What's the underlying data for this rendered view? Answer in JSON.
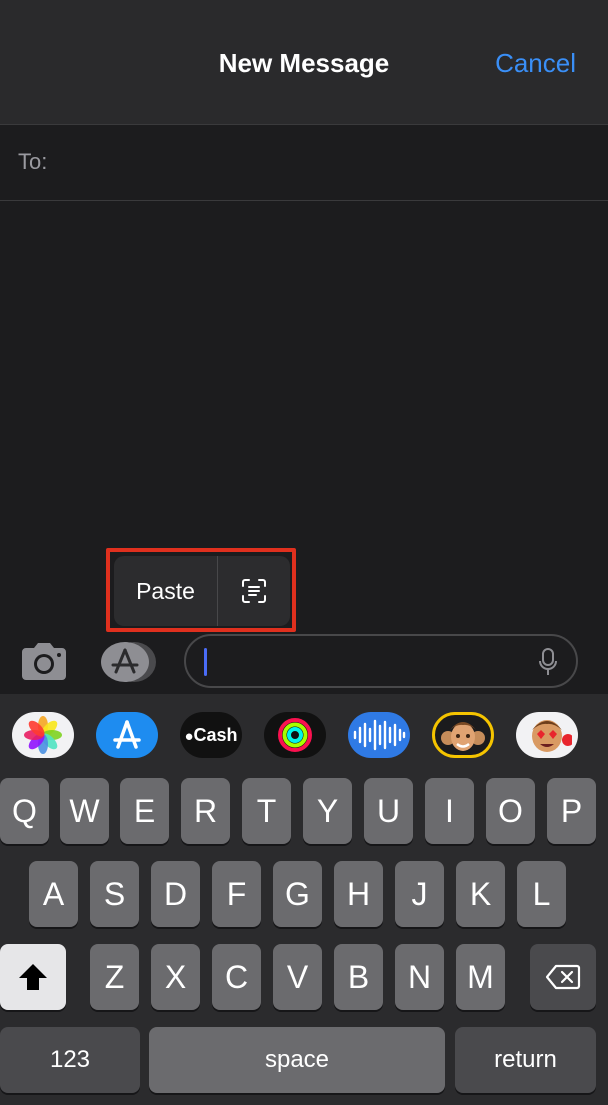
{
  "header": {
    "title": "New Message",
    "cancel_label": "Cancel"
  },
  "recipient": {
    "label": "To:",
    "value": ""
  },
  "edit_menu": {
    "paste_label": "Paste",
    "scan_icon": "scan-text-icon"
  },
  "compose": {
    "value": "",
    "camera_icon": "camera-icon",
    "apps_icon": "app-store-icon",
    "mic_icon": "microphone-icon"
  },
  "app_strip": [
    {
      "name": "Photos",
      "icon": "photos-icon"
    },
    {
      "name": "App Store",
      "icon": "app-store-icon"
    },
    {
      "name": "Cash",
      "icon": "apple-cash-icon",
      "text": "Cash"
    },
    {
      "name": "Activity",
      "icon": "activity-rings-icon"
    },
    {
      "name": "Audio",
      "icon": "audio-waveform-icon"
    },
    {
      "name": "Memoji",
      "icon": "memoji-icon"
    },
    {
      "name": "Memoji Stickers",
      "icon": "memoji-stickers-icon"
    }
  ],
  "keyboard": {
    "row1": [
      "Q",
      "W",
      "E",
      "R",
      "T",
      "Y",
      "U",
      "I",
      "O",
      "P"
    ],
    "row2": [
      "A",
      "S",
      "D",
      "F",
      "G",
      "H",
      "J",
      "K",
      "L"
    ],
    "row3": [
      "Z",
      "X",
      "C",
      "V",
      "B",
      "N",
      "M"
    ],
    "numbers_label": "123",
    "space_label": "space",
    "return_label": "return",
    "shift_icon": "shift-icon",
    "delete_icon": "backspace-icon"
  },
  "colors": {
    "accent": "#3a8ff7",
    "highlight": "#e0301e",
    "caret": "#4a6cf7"
  }
}
